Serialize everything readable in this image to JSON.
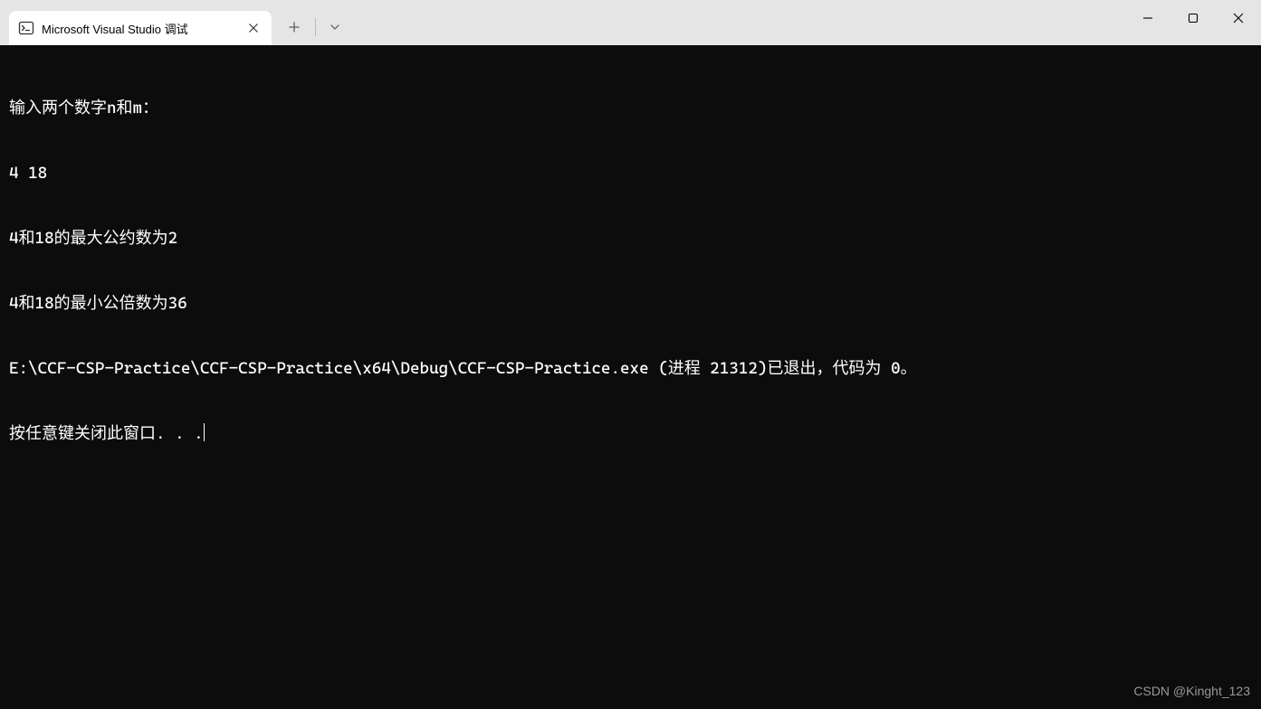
{
  "tab": {
    "title": "Microsoft Visual Studio 调试"
  },
  "terminal": {
    "lines": [
      "输入两个数字n和m：",
      "4 18",
      "4和18的最大公约数为2",
      "4和18的最小公倍数为36",
      "E:\\CCF-CSP-Practice\\CCF-CSP-Practice\\x64\\Debug\\CCF-CSP-Practice.exe (进程 21312)已退出，代码为 0。",
      "按任意键关闭此窗口. . ."
    ]
  },
  "watermark": "CSDN @Kinght_123"
}
